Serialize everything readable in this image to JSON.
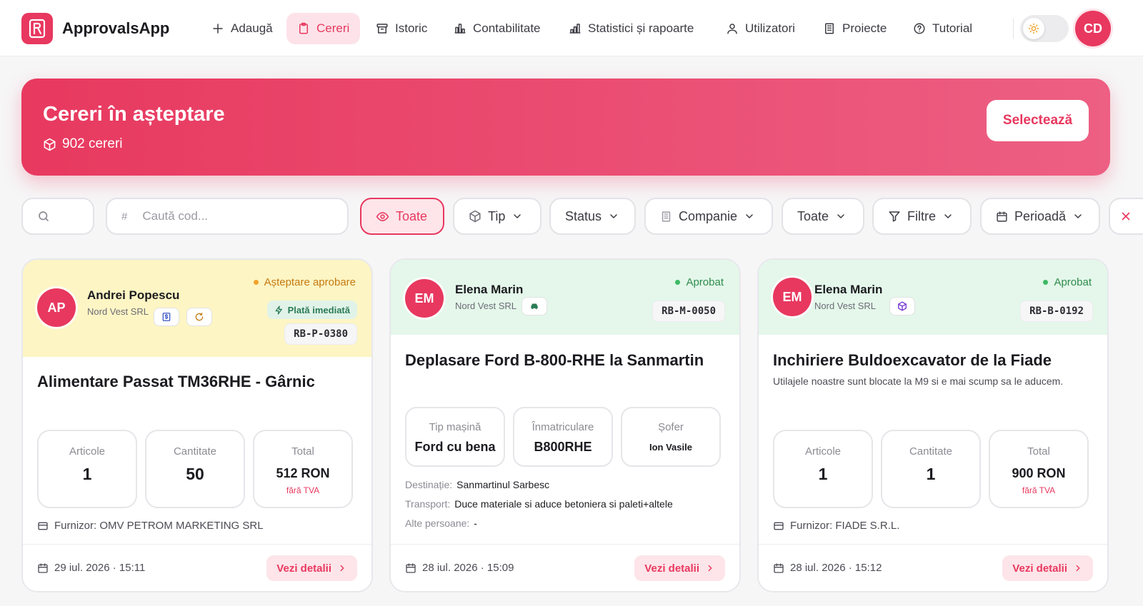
{
  "app": {
    "name": "ApprovalsApp",
    "user_initials": "CD"
  },
  "nav": {
    "items": [
      {
        "label": "Adaugă",
        "icon": "plus-icon"
      },
      {
        "label": "Cereri",
        "icon": "clipboard-icon",
        "active": true
      },
      {
        "label": "Istoric",
        "icon": "archive-icon"
      },
      {
        "label": "Contabilitate",
        "icon": "bar-chart-icon"
      },
      {
        "label": "Statistici și rapoarte",
        "icon": "bar-chart-icon"
      },
      {
        "label": "Utilizatori",
        "icon": "users-icon"
      },
      {
        "label": "Proiecte",
        "icon": "building-icon"
      },
      {
        "label": "Tutorial",
        "icon": "help-circle-icon"
      }
    ]
  },
  "hero": {
    "title": "Cereri în așteptare",
    "count": "902 cereri",
    "select_label": "Selectează"
  },
  "filters": {
    "search_placeholder": "",
    "code_placeholder": "Caută cod...",
    "all_label": "Toate",
    "type_label": "Tip",
    "status_label": "Status",
    "company_label": "Companie",
    "scope_label": "Toate",
    "more_label": "Filtre",
    "period_label": "Perioadă"
  },
  "colors": {
    "accent": "#e8385f",
    "pending_bg": "#fdf5c4",
    "approved_bg": "#e4f7ea"
  },
  "cards": [
    {
      "initials": "AP",
      "name": "Andrei Popescu",
      "company": "Nord Vest SRL",
      "status": "Așteptare aprobare",
      "badge": "Plată imediată",
      "code": "RB-P-0380",
      "title": "Alimentare Passat TM36RHE - Gârnic",
      "stats": [
        {
          "label": "Articole",
          "value": "1"
        },
        {
          "label": "Cantitate",
          "value": "50"
        },
        {
          "label": "Total",
          "value": "512 RON",
          "sub": "fără TVA"
        }
      ],
      "supplier": "Furnizor: OMV PETROM MARKETING SRL",
      "date": "29 iul. 2026 · 15:11",
      "details_label": "Vezi detalii"
    },
    {
      "initials": "EM",
      "name": "Elena Marin",
      "company": "Nord Vest SRL",
      "status": "Aprobat",
      "code": "RB-M-0050",
      "title": "Deplasare Ford B-800-RHE la Sanmartin",
      "stats": [
        {
          "label": "Tip mașină",
          "value": "Ford cu bena"
        },
        {
          "label": "Înmatriculare",
          "value": "B800RHE"
        },
        {
          "label": "Șofer",
          "value": "Ion Vasile"
        }
      ],
      "details": [
        {
          "key": "Destinație:",
          "value": "Sanmartinul Sarbesc"
        },
        {
          "key": "Transport:",
          "value": "Duce materiale si aduce betoniera si paleti+altele"
        },
        {
          "key": "Alte persoane:",
          "value": "-"
        }
      ],
      "date": "28 iul. 2026 · 15:09",
      "details_label": "Vezi detalii"
    },
    {
      "initials": "EM",
      "name": "Elena Marin",
      "company": "Nord Vest SRL",
      "status": "Aprobat",
      "code": "RB-B-0192",
      "title": "Inchiriere Buldoexcavator de la Fiade",
      "description": "Utilajele noastre sunt blocate la M9 si e mai scump sa le aducem.",
      "stats": [
        {
          "label": "Articole",
          "value": "1"
        },
        {
          "label": "Cantitate",
          "value": "1"
        },
        {
          "label": "Total",
          "value": "900 RON",
          "sub": "fără TVA"
        }
      ],
      "supplier": "Furnizor: FIADE S.R.L.",
      "date": "28 iul. 2026 · 15:12",
      "details_label": "Vezi detalii"
    }
  ]
}
